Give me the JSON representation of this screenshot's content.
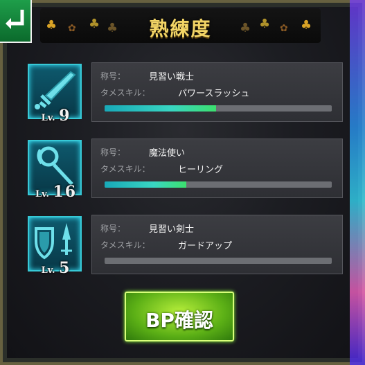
{
  "header": {
    "title": "熟練度"
  },
  "labels": {
    "title_label": "称号：",
    "skill_label": "タメスキル："
  },
  "entries": [
    {
      "icon": "sword-icon",
      "lv_prefix": "Lv.",
      "level": "9",
      "title": "見習い戦士",
      "skill": "パワースラッシュ",
      "progress": 0.49
    },
    {
      "icon": "staff-icon",
      "lv_prefix": "Lv.",
      "level": "16",
      "title": "魔法使い",
      "skill": "ヒーリング",
      "progress": 0.36
    },
    {
      "icon": "shield-and-dagger-icon",
      "lv_prefix": "Lv.",
      "level": "5",
      "title": "見習い剣士",
      "skill": "ガードアップ",
      "progress": 0.0
    }
  ],
  "button": {
    "label": "BP確認"
  },
  "colors": {
    "title_gold": "#f3d566",
    "bar_fill": "#39d6c2",
    "button_green": "#5cb016",
    "icon_cyan": "#37c9d6"
  }
}
